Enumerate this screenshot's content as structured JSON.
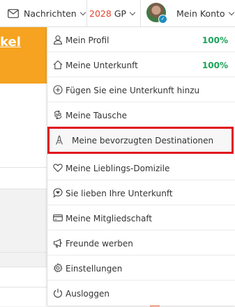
{
  "topbar": {
    "messages_label": "Nachrichten",
    "gp_value": "2028",
    "gp_unit": "GP",
    "account_label": "Mein Konto"
  },
  "background": {
    "banner_text": "kel"
  },
  "menu": {
    "items": [
      {
        "label": "Mein Profil",
        "icon": "user-icon",
        "percent": "100%"
      },
      {
        "label": "Meine Unterkunft",
        "icon": "home-icon",
        "percent": "100%"
      },
      {
        "label": "Fügen Sie eine Unterkunft hinzu",
        "icon": "plus-circle-icon"
      },
      {
        "label": "Meine Tausche",
        "icon": "exchange-icon"
      },
      {
        "label": "Meine bevorzugten Destinationen",
        "icon": "eiffel-tower-icon",
        "highlighted": true
      },
      {
        "label": "Meine Lieblings-Domizile",
        "icon": "heart-icon"
      },
      {
        "label": "Sie lieben Ihre Unterkunft",
        "icon": "chat-heart-icon"
      },
      {
        "label": "Meine Mitgliedschaft",
        "icon": "card-icon"
      },
      {
        "label": "Freunde werben",
        "icon": "megaphone-icon"
      },
      {
        "label": "Einstellungen",
        "icon": "gear-icon"
      },
      {
        "label": "Ausloggen",
        "icon": "power-icon"
      }
    ],
    "highlight_color": "#e0141e",
    "percent_color": "#1aa35a"
  },
  "colors": {
    "brand_orange": "#f5a320",
    "gp_red": "#e8442e"
  }
}
